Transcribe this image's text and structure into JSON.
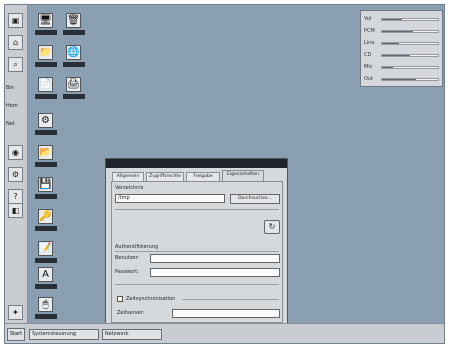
{
  "taskbar": {
    "start_label": "Start",
    "tasks": [
      "Systemsteuerung",
      "Netzwerk"
    ]
  },
  "quicklaunch": {
    "side_labels": [
      "Bin",
      "Hom",
      "Net"
    ]
  },
  "dialog": {
    "tabs": [
      "Allgemein",
      "Zugriffsrechte",
      "Freigabe",
      "Eigenschaften"
    ],
    "name_label": "Verzeichnis",
    "name_value": "/tmp",
    "browse_button": "Durchsuchen...",
    "auth_section": "Authentifizierung",
    "user_label": "Benutzer:",
    "user_value": "",
    "password_label": "Passwort:",
    "password_value": "",
    "checkbox_label": "Zeitsynchronisation",
    "server_label": "Zeitserver:",
    "server_value": ""
  },
  "mixer": {
    "rows": [
      {
        "label": "Vol",
        "level": 0.35
      },
      {
        "label": "PCM",
        "level": 0.55
      },
      {
        "label": "Line",
        "level": 0.3
      },
      {
        "label": "CD",
        "level": 0.5
      },
      {
        "label": "Mic",
        "level": 0.2
      },
      {
        "label": "Out",
        "level": 0.6
      }
    ]
  },
  "icons": {
    "desktop_glyphs": [
      "🖥",
      "🗑",
      "📁",
      "🌐",
      "📄",
      "🖨",
      "⚙",
      "🔧",
      "📂",
      "🔑",
      "💾",
      "📝",
      "A",
      "🖱"
    ]
  }
}
